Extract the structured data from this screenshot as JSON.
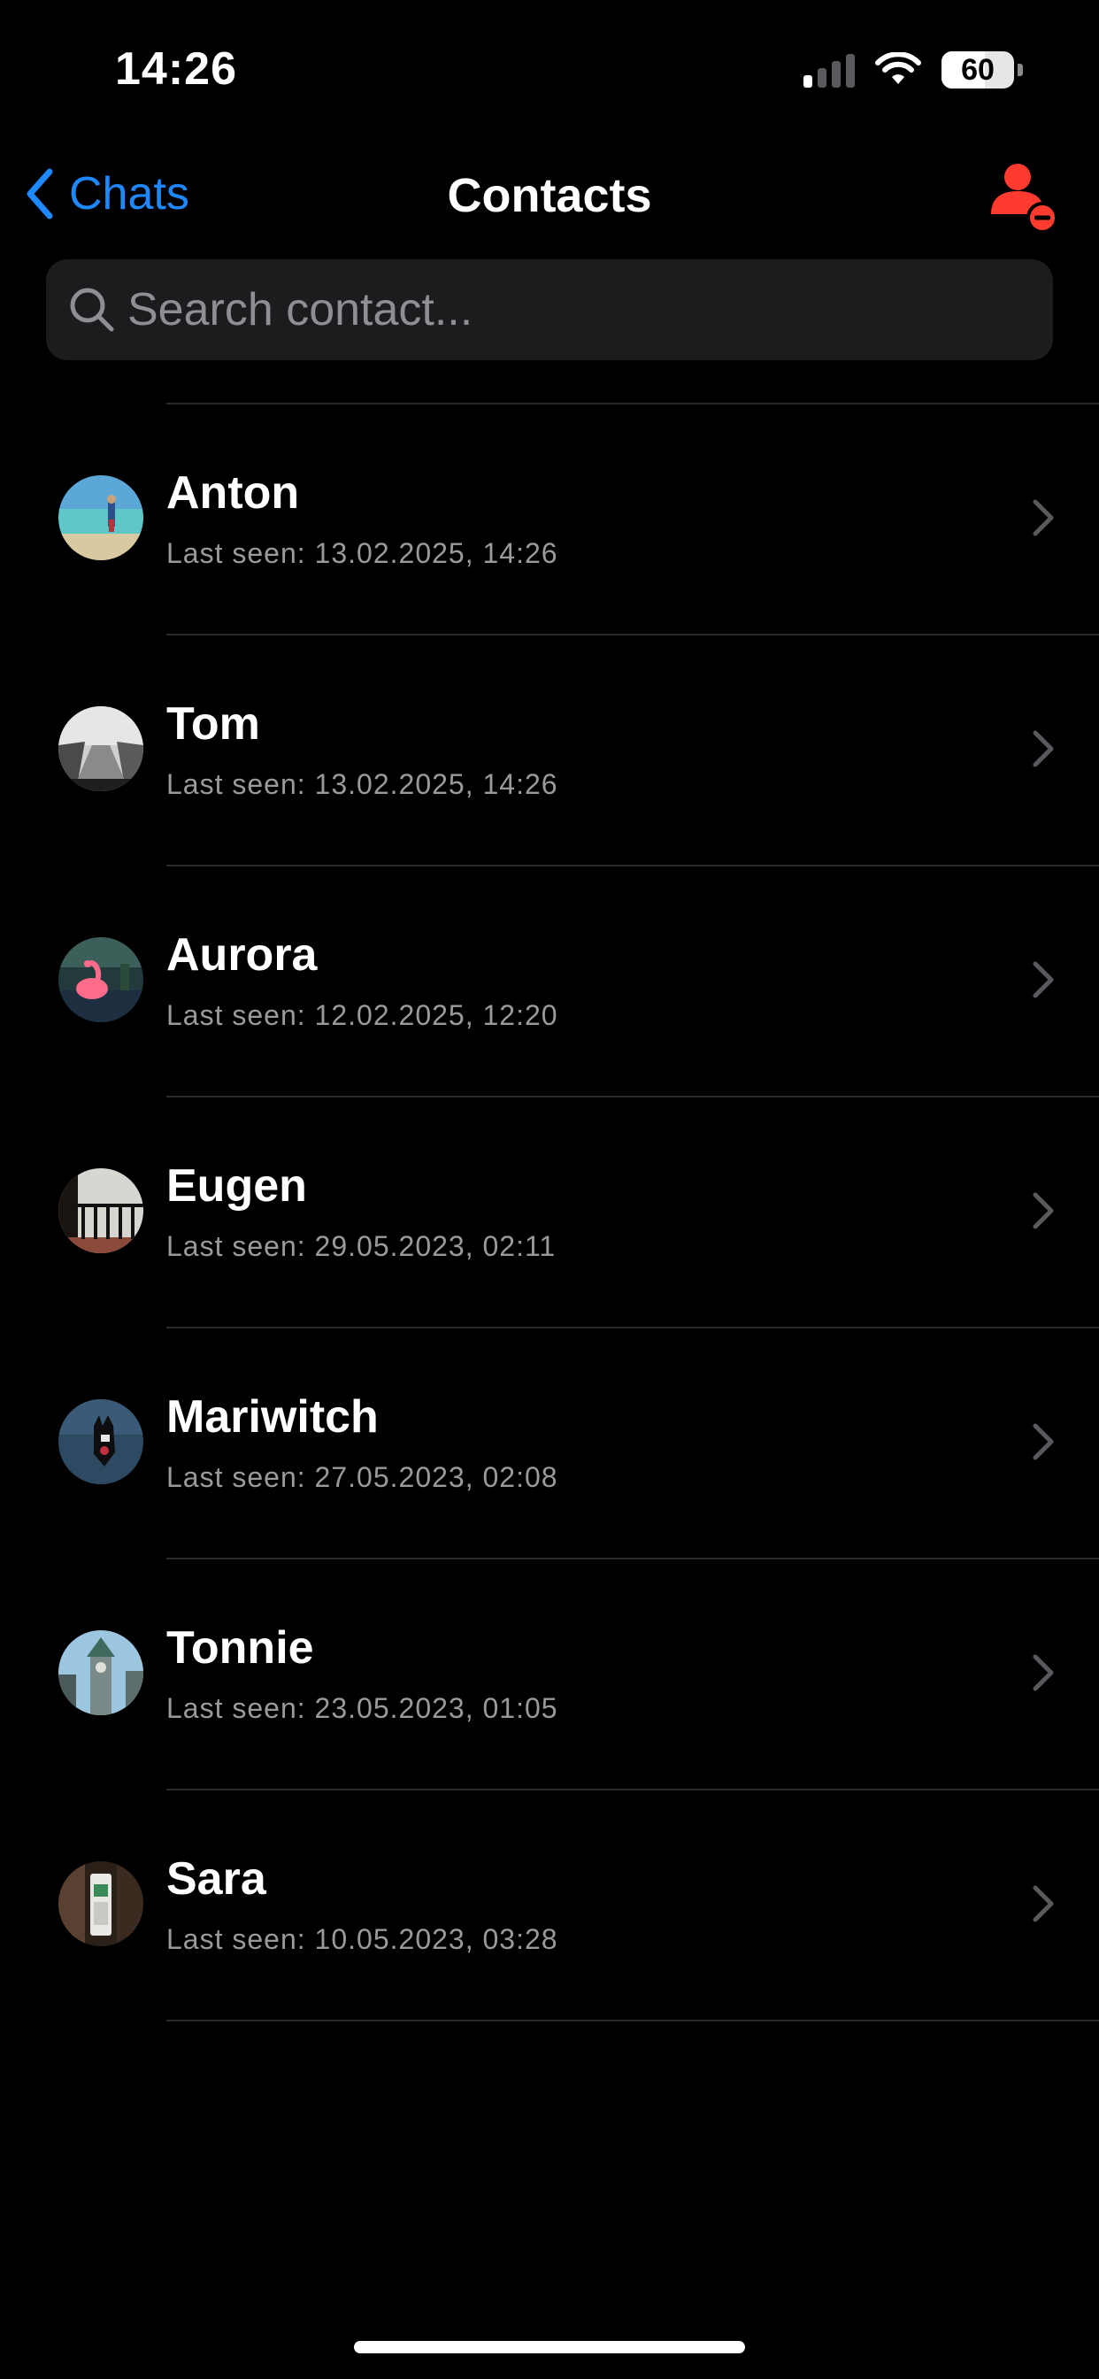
{
  "status_bar": {
    "time": "14:26",
    "battery": "60",
    "battery_level": 0.6,
    "signal_bars_on": 1
  },
  "nav": {
    "back_label": "Chats",
    "title": "Contacts",
    "accent_color": "#1e88ff",
    "remove_icon_color": "#ff3b30"
  },
  "search": {
    "placeholder": "Search contact..."
  },
  "contacts": [
    {
      "name": "Anton",
      "last_seen": "Last seen: 13.02.2025, 14:26",
      "avatar_icon": "beach-photo-avatar"
    },
    {
      "name": "Tom",
      "last_seen": "Last seen: 13.02.2025, 14:26",
      "avatar_icon": "road-photo-avatar"
    },
    {
      "name": "Aurora",
      "last_seen": "Last seen: 12.02.2025, 12:20",
      "avatar_icon": "flamingo-photo-avatar"
    },
    {
      "name": "Eugen",
      "last_seen": "Last seen: 29.05.2023, 02:11",
      "avatar_icon": "balcony-photo-avatar"
    },
    {
      "name": "Mariwitch",
      "last_seen": "Last seen: 27.05.2023, 02:08",
      "avatar_icon": "cat-photo-avatar"
    },
    {
      "name": "Tonnie",
      "last_seen": "Last seen: 23.05.2023, 01:05",
      "avatar_icon": "tower-photo-avatar"
    },
    {
      "name": "Sara",
      "last_seen": "Last seen: 10.05.2023, 03:28",
      "avatar_icon": "shop-photo-avatar"
    }
  ]
}
